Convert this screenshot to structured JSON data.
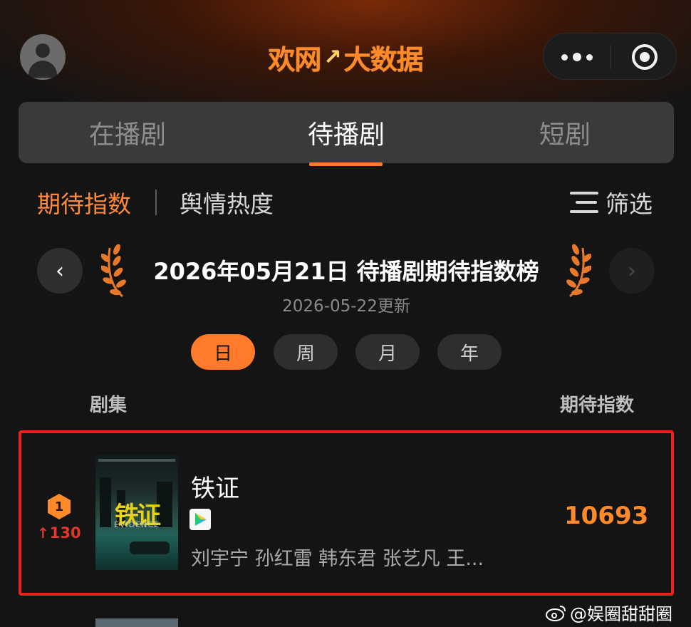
{
  "header": {
    "logo_text_left": "欢网",
    "logo_spark": "↗",
    "logo_text_right": "大数据",
    "avatar_icon": "user-avatar-icon",
    "more_icon": "more-dots-icon",
    "target_icon": "target-circle-icon"
  },
  "tabs": [
    {
      "label": "在播剧",
      "active": false
    },
    {
      "label": "待播剧",
      "active": true
    },
    {
      "label": "短剧",
      "active": false
    }
  ],
  "subtabs": {
    "active": "期待指数",
    "inactive": "舆情热度",
    "filter_label": "筛选"
  },
  "board": {
    "title": "2026年05月21日 待播剧期待指数榜",
    "updated": "2026-05-22更新",
    "prev": "‹",
    "next": "›"
  },
  "periods": [
    {
      "label": "日",
      "active": true
    },
    {
      "label": "周",
      "active": false
    },
    {
      "label": "月",
      "active": false
    },
    {
      "label": "年",
      "active": false
    }
  ],
  "columns": {
    "left": "剧集",
    "right": "期待指数"
  },
  "rows": [
    {
      "rank": "1",
      "change": "130",
      "change_arrow": "↑",
      "title": "铁证",
      "poster_title": "铁证",
      "poster_subtitle": "EVIDENCE",
      "cast": "刘宇宁 孙红雷 韩东君 张艺凡 王...",
      "score": "10693"
    }
  ],
  "watermark": "@娱圈甜甜圈",
  "colors": {
    "accent": "#ff7a2a",
    "highlight_border": "#e8231c",
    "rank_up": "#e2372c",
    "background": "#141414"
  }
}
